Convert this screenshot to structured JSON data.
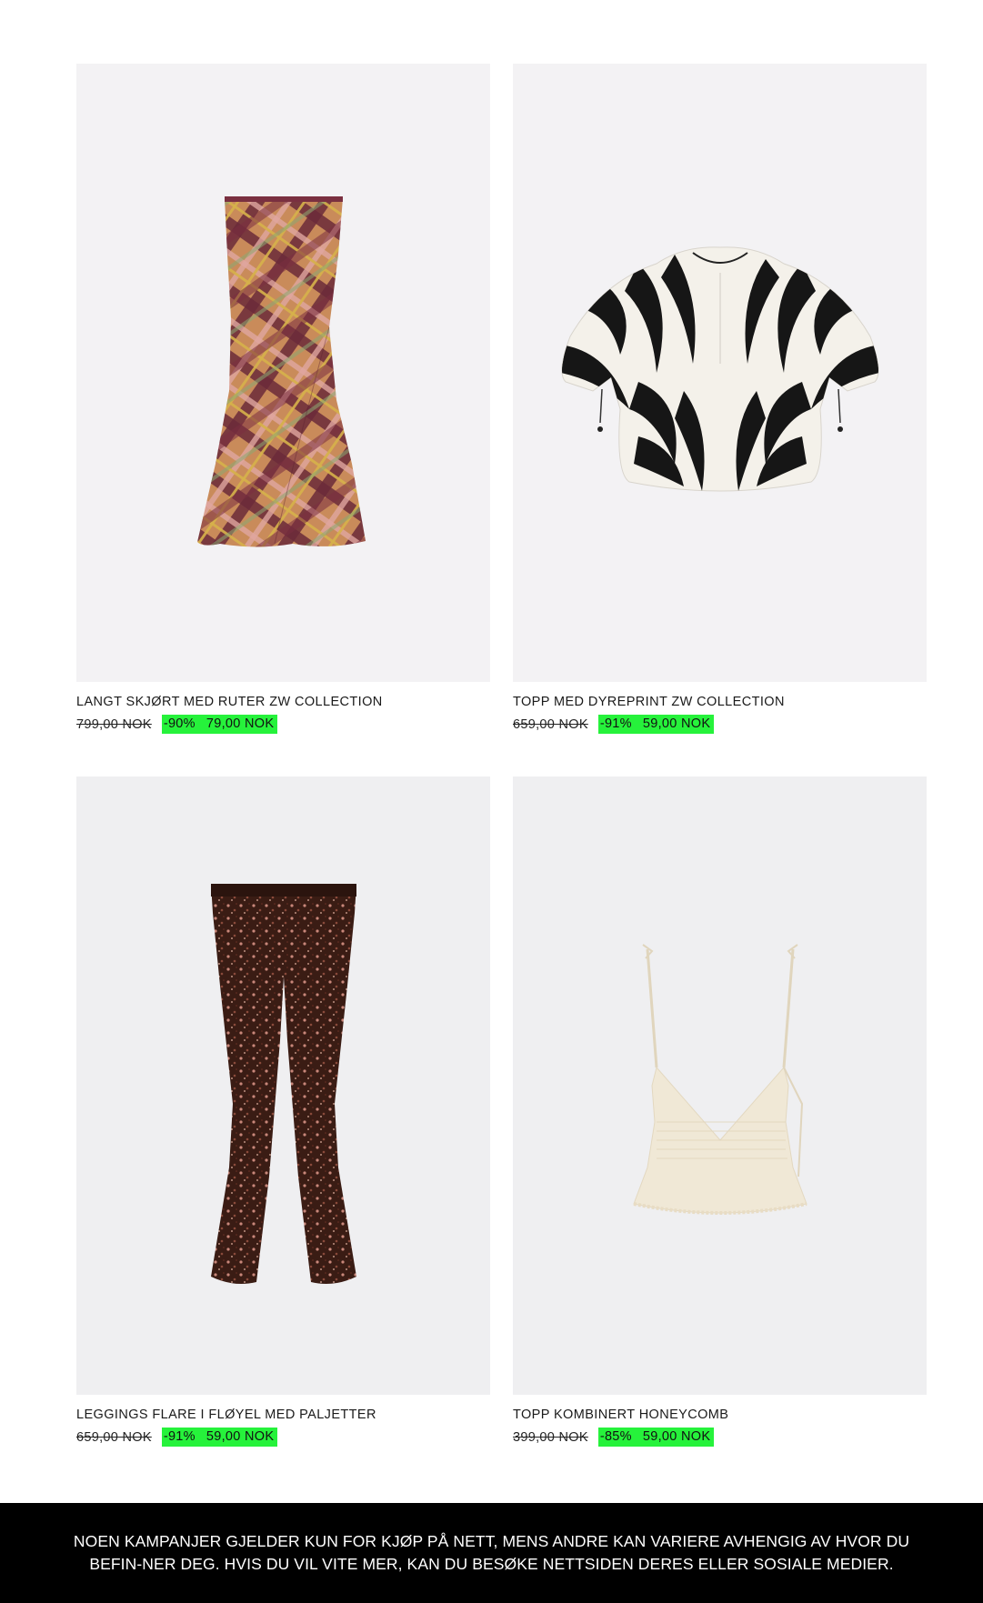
{
  "products": [
    {
      "title": "LANGT SKJØRT MED RUTER ZW COLLECTION",
      "old_price": "799,00 NOK",
      "discount": "-90%",
      "new_price": "79,00 NOK",
      "image": "plaid-maxi-skirt"
    },
    {
      "title": "TOPP MED DYREPRINT ZW COLLECTION",
      "old_price": "659,00 NOK",
      "discount": "-91%",
      "new_price": "59,00 NOK",
      "image": "zebra-print-blouse"
    },
    {
      "title": "LEGGINGS FLARE I FLØYEL MED PALJETTER",
      "old_price": "659,00 NOK",
      "discount": "-91%",
      "new_price": "59,00 NOK",
      "image": "sequin-flare-leggings"
    },
    {
      "title": "TOPP KOMBINERT HONEYCOMB",
      "old_price": "399,00 NOK",
      "discount": "-85%",
      "new_price": "59,00 NOK",
      "image": "cream-smocked-camisole"
    }
  ],
  "footer": {
    "text": "NOEN KAMPANJER GJELDER KUN FOR KJØP PÅ NETT, MENS ANDRE KAN VARIERE AVHENGIG AV HVOR DU BEFIN-NER DEG. HVIS DU VIL VITE MER, KAN DU BESØKE NETTSIDEN DERES ELLER SOSIALE MEDIER."
  },
  "colors": {
    "discount_highlight": "#26f23b",
    "image_background": "#f3f2f4",
    "footer_background": "#000000"
  }
}
